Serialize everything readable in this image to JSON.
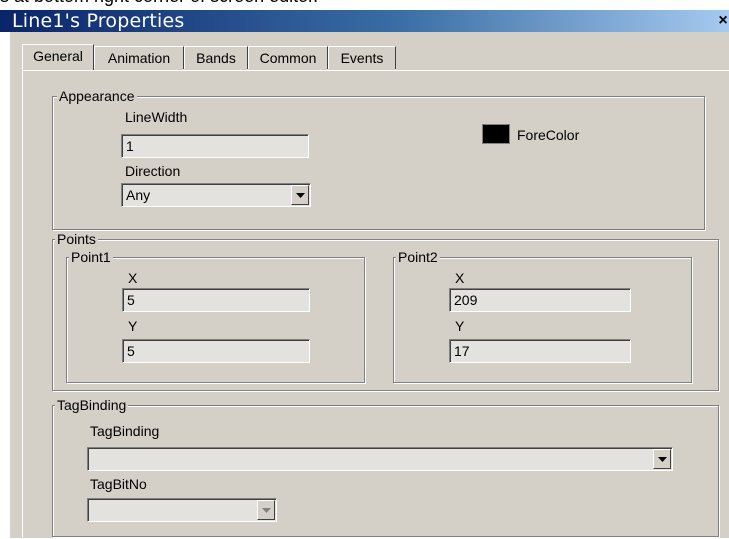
{
  "doc_fragment": "s at bottom right corner of screen editor.",
  "window": {
    "title": "Line1's Properties",
    "close_glyph": "×"
  },
  "tabs": [
    {
      "label": "General",
      "active": true
    },
    {
      "label": "Animation",
      "active": false
    },
    {
      "label": "Bands",
      "active": false
    },
    {
      "label": "Common",
      "active": false
    },
    {
      "label": "Events",
      "active": false
    }
  ],
  "appearance": {
    "legend": "Appearance",
    "linewidth_label": "LineWidth",
    "linewidth_value": "1",
    "direction_label": "Direction",
    "direction_value": "Any",
    "forecolor_label": "ForeColor",
    "forecolor": "#000000"
  },
  "points": {
    "legend": "Points",
    "point1": {
      "legend": "Point1",
      "x_label": "X",
      "x_value": "5",
      "y_label": "Y",
      "y_value": "5"
    },
    "point2": {
      "legend": "Point2",
      "x_label": "X",
      "x_value": "209",
      "y_label": "Y",
      "y_value": "17"
    }
  },
  "tagbinding": {
    "legend": "TagBinding",
    "tagbinding_label": "TagBinding",
    "tagbinding_value": "",
    "tagbitno_label": "TagBitNo",
    "tagbitno_value": ""
  },
  "colors": {
    "dialog_bg": "#d4d0c8",
    "titlebar_start": "#0a246a",
    "titlebar_end": "#a6caf0"
  }
}
